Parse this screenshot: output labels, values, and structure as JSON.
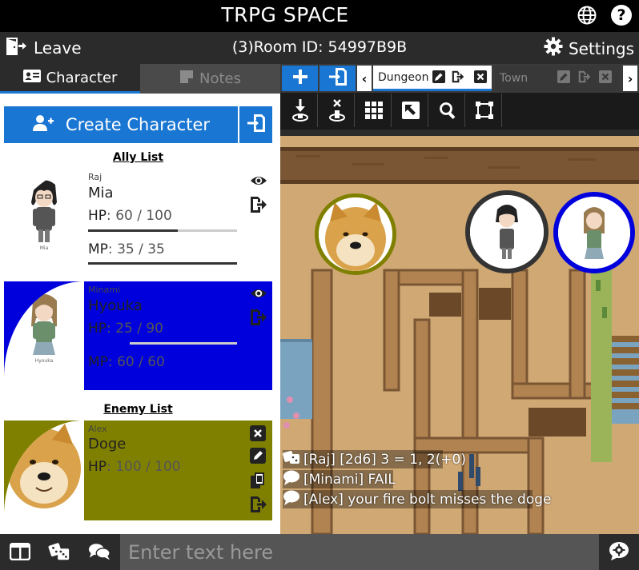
{
  "app": {
    "title": "TRPG SPACE"
  },
  "header": {
    "globe_icon": "globe-icon",
    "help_label": "?"
  },
  "room": {
    "leave_label": "Leave",
    "room_id": "(3)Room ID: 54997B9B",
    "settings_label": "Settings"
  },
  "left_tabs": [
    {
      "label": "Character",
      "icon": "id-card-icon",
      "active": true
    },
    {
      "label": "Notes",
      "icon": "note-icon",
      "active": false
    }
  ],
  "create_character_label": "Create Character",
  "ally_list_label": "Ally List",
  "enemy_list_label": "Enemy List",
  "allies": [
    {
      "player": "Raj",
      "name": "Mia",
      "hp_label": "HP",
      "hp": "60 / 100",
      "hp_fraction": 0.6,
      "mp_label": "MP",
      "mp": "35 / 35",
      "mp_fraction": 1.0,
      "color": "#333333",
      "sprite_caption": "Mia"
    },
    {
      "player": "Minami",
      "name": "Hyouka",
      "hp_label": "HP",
      "hp": "25 / 90",
      "hp_fraction": 0.28,
      "mp_label": "MP",
      "mp": "60 / 60",
      "mp_fraction": 1.0,
      "color": "#0000dd",
      "sprite_caption": "Hyouka"
    }
  ],
  "enemies": [
    {
      "player": "Alex",
      "name": "Doge",
      "hp_label": "HP",
      "hp": "100 / 100",
      "hp_fraction": 1.0,
      "color": "#808000"
    }
  ],
  "map_tabs": [
    {
      "label": "Dungeon",
      "active": true
    },
    {
      "label": "Town",
      "active": false
    }
  ],
  "toolbar": [
    "add-token-down-icon",
    "remove-token-icon",
    "grid-icon",
    "resize-icon",
    "zoom-icon",
    "select-area-icon"
  ],
  "chat": [
    {
      "icon": "dice-icon",
      "text": "[Raj] [2d6] 3 = 1, 2(+0)"
    },
    {
      "icon": "speech-icon",
      "text": "[Minami] FAIL"
    },
    {
      "icon": "speech-icon",
      "text": "[Alex] your fire bolt misses the doge"
    }
  ],
  "bottom": {
    "input_placeholder": "Enter text here"
  }
}
